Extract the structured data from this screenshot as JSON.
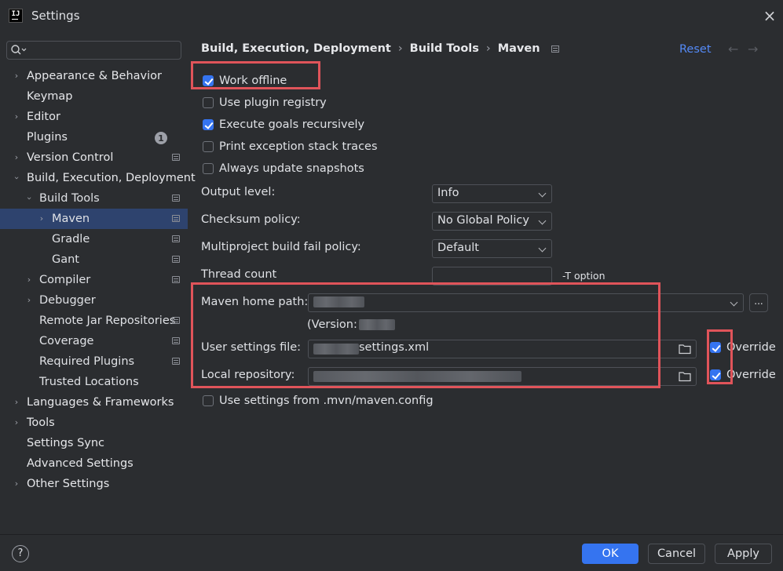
{
  "window": {
    "title": "Settings",
    "app_logo": "IJ"
  },
  "search": {
    "value": "",
    "placeholder": ""
  },
  "sidebar": {
    "items": [
      {
        "label": "Appearance & Behavior"
      },
      {
        "label": "Keymap"
      },
      {
        "label": "Editor"
      },
      {
        "label": "Plugins",
        "badge": "1"
      },
      {
        "label": "Version Control"
      },
      {
        "label": "Build, Execution, Deployment"
      },
      {
        "label": "Build Tools"
      },
      {
        "label": "Maven"
      },
      {
        "label": "Gradle"
      },
      {
        "label": "Gant"
      },
      {
        "label": "Compiler"
      },
      {
        "label": "Debugger"
      },
      {
        "label": "Remote Jar Repositories"
      },
      {
        "label": "Coverage"
      },
      {
        "label": "Required Plugins"
      },
      {
        "label": "Trusted Locations"
      },
      {
        "label": "Languages & Frameworks"
      },
      {
        "label": "Tools"
      },
      {
        "label": "Settings Sync"
      },
      {
        "label": "Advanced Settings"
      },
      {
        "label": "Other Settings"
      }
    ]
  },
  "breadcrumb": {
    "part1": "Build, Execution, Deployment",
    "part2": "Build Tools",
    "part3": "Maven",
    "sep": "›"
  },
  "header": {
    "reset_label": "Reset",
    "back_icon": "←",
    "forward_icon": "→"
  },
  "options": {
    "work_offline": {
      "label": "Work offline",
      "checked": true
    },
    "use_plugin_registry": {
      "label": "Use plugin registry",
      "checked": false
    },
    "execute_goals_recursively": {
      "label": "Execute goals recursively",
      "checked": true
    },
    "print_exception_stack_traces": {
      "label": "Print exception stack traces",
      "checked": false
    },
    "always_update_snapshots": {
      "label": "Always update snapshots",
      "checked": false
    }
  },
  "fields": {
    "output_level": {
      "label": "Output level:",
      "value": "Info"
    },
    "checksum_policy": {
      "label": "Checksum policy:",
      "value": "No Global Policy"
    },
    "multiproject_fail_policy": {
      "label": "Multiproject build fail policy:",
      "value": "Default"
    },
    "thread_count": {
      "label": "Thread count",
      "value": "",
      "suffix": "-T option"
    },
    "maven_home": {
      "label": "Maven home path:",
      "version_prefix": "(Version:",
      "browse_label": "..."
    },
    "user_settings": {
      "label": "User settings file:",
      "value_visible": "settings.xml",
      "override_label": "Override",
      "override_checked": true
    },
    "local_repository": {
      "label": "Local repository:",
      "override_label": "Override",
      "override_checked": true
    },
    "use_mvn_config": {
      "label": "Use settings from .mvn/maven.config",
      "checked": false
    }
  },
  "footer": {
    "help_label": "?",
    "ok_label": "OK",
    "cancel_label": "Cancel",
    "apply_label": "Apply"
  },
  "colors": {
    "accent": "#3574f0",
    "selection": "#2e436e",
    "highlight_box": "#e0545a",
    "link": "#548af7"
  }
}
